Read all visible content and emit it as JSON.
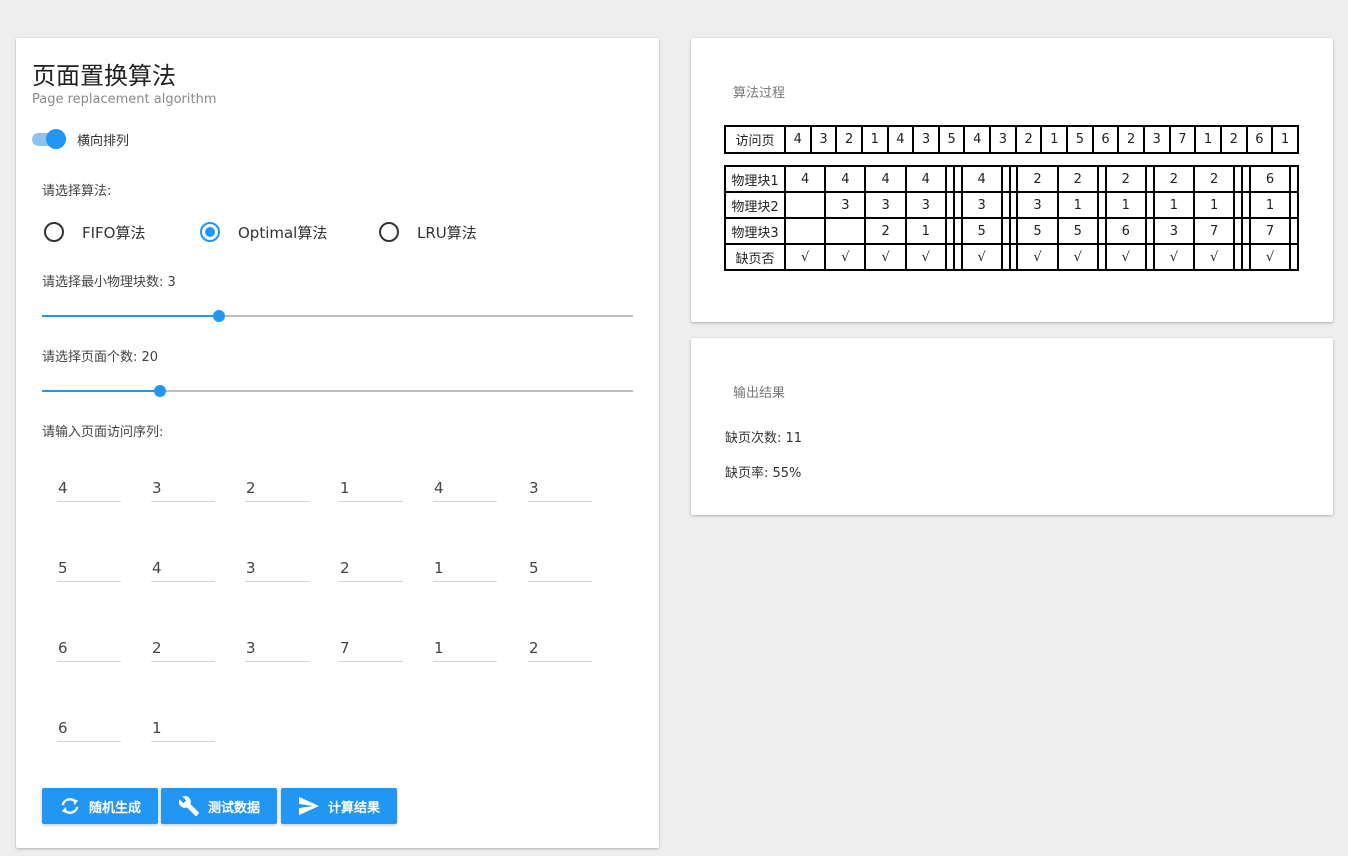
{
  "header": {
    "title": "页面置换算法",
    "subtitle": "Page replacement algorithm",
    "toggle_label": "横向排列",
    "toggle_on": true
  },
  "algorithm": {
    "label": "请选择算法:",
    "options": [
      "FIFO算法",
      "Optimal算法",
      "LRU算法"
    ],
    "selected": "Optimal算法"
  },
  "blocks": {
    "label": "请选择最小物理块数: 3",
    "value": 3,
    "level": 0.3
  },
  "pages": {
    "label": "请选择页面个数: 20",
    "value": 20,
    "level": 0.2
  },
  "sequence": {
    "label": "请输入页面访问序列:",
    "values": [
      "4",
      "3",
      "2",
      "1",
      "4",
      "3",
      "5",
      "4",
      "3",
      "2",
      "1",
      "5",
      "6",
      "2",
      "3",
      "7",
      "1",
      "2",
      "6",
      "1"
    ]
  },
  "buttons": {
    "random": "随机生成",
    "test": "测试数据",
    "compute": "计算结果"
  },
  "process": {
    "heading": "算法过程",
    "access_label": "访问页",
    "access": [
      "4",
      "3",
      "2",
      "1",
      "4",
      "3",
      "5",
      "4",
      "3",
      "2",
      "1",
      "5",
      "6",
      "2",
      "3",
      "7",
      "1",
      "2",
      "6",
      "1"
    ],
    "rows": [
      {
        "label": "物理块1",
        "cells": [
          "4",
          "4",
          "4",
          "4",
          "",
          "",
          "4",
          "",
          "",
          "2",
          "2",
          "",
          "2",
          "",
          "2",
          "2",
          "",
          "",
          "6",
          ""
        ]
      },
      {
        "label": "物理块2",
        "cells": [
          "",
          "3",
          "3",
          "3",
          "",
          "",
          "3",
          "",
          "",
          "3",
          "1",
          "",
          "1",
          "",
          "1",
          "1",
          "",
          "",
          "1",
          ""
        ]
      },
      {
        "label": "物理块3",
        "cells": [
          "",
          "",
          "2",
          "1",
          "",
          "",
          "5",
          "",
          "",
          "5",
          "5",
          "",
          "6",
          "",
          "3",
          "7",
          "",
          "",
          "7",
          ""
        ]
      },
      {
        "label": "缺页否",
        "cells": [
          "√",
          "√",
          "√",
          "√",
          "",
          "",
          "√",
          "",
          "",
          "√",
          "√",
          "",
          "√",
          "",
          "√",
          "√",
          "",
          "",
          "√",
          ""
        ]
      }
    ]
  },
  "result": {
    "heading": "输出结果",
    "faults": "缺页次数: 11",
    "rate": "缺页率: 55%"
  },
  "colors": {
    "accent": "#2196f3",
    "background": "#eeeeee"
  },
  "icons": {
    "random": "refresh-icon",
    "test": "wrench-icon",
    "compute": "send-icon"
  }
}
